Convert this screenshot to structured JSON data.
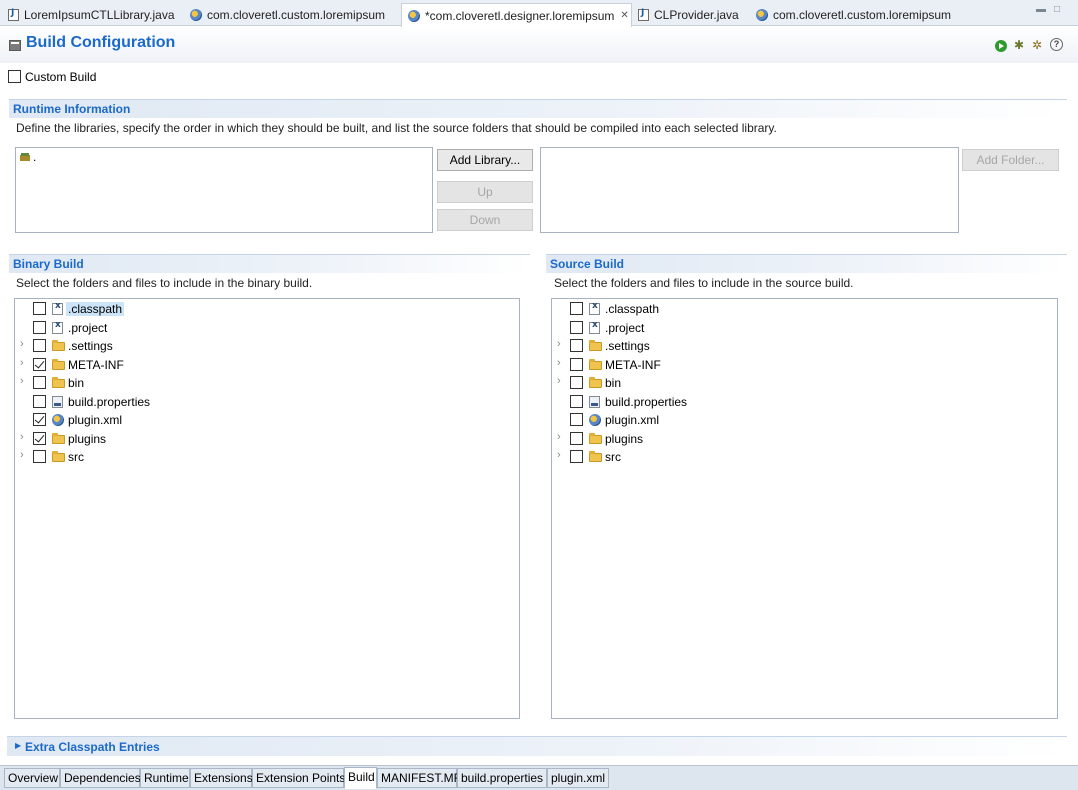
{
  "editor_tabs": [
    {
      "label": "LoremIpsumCTLLibrary.java",
      "icon": "java-file-icon",
      "active": false
    },
    {
      "label": "com.cloveretl.custom.loremipsum",
      "icon": "plugin-icon",
      "active": false
    },
    {
      "label": "*com.cloveretl.designer.loremipsum",
      "icon": "plugin-icon",
      "active": true
    },
    {
      "label": "CLProvider.java",
      "icon": "java-file-icon",
      "active": false
    },
    {
      "label": "com.cloveretl.custom.loremipsum",
      "icon": "plugin-icon",
      "active": false
    }
  ],
  "form": {
    "title": "Build Configuration"
  },
  "custom_build": {
    "label": "Custom Build",
    "checked": false
  },
  "runtime": {
    "title": "Runtime Information",
    "description": "Define the libraries, specify the order in which they should be built, and list the source folders that should be compiled into each selected library.",
    "libraries": [
      "."
    ],
    "add_library": "Add Library...",
    "up": "Up",
    "down": "Down",
    "add_folder": "Add Folder..."
  },
  "binary_build": {
    "title": "Binary Build",
    "description": "Select the folders and files to include in the binary build.",
    "items": [
      {
        "name": ".classpath",
        "type": "file",
        "checked": false,
        "expandable": false,
        "selected": true
      },
      {
        "name": ".project",
        "type": "file",
        "checked": false,
        "expandable": false,
        "selected": false
      },
      {
        "name": ".settings",
        "type": "folder",
        "checked": false,
        "expandable": true,
        "selected": false
      },
      {
        "name": "META-INF",
        "type": "folder",
        "checked": true,
        "expandable": true,
        "selected": false
      },
      {
        "name": "bin",
        "type": "folder",
        "checked": false,
        "expandable": true,
        "selected": false
      },
      {
        "name": "build.properties",
        "type": "properties",
        "checked": false,
        "expandable": false,
        "selected": false
      },
      {
        "name": "plugin.xml",
        "type": "plugin",
        "checked": true,
        "expandable": false,
        "selected": false
      },
      {
        "name": "plugins",
        "type": "folder",
        "checked": true,
        "expandable": true,
        "selected": false
      },
      {
        "name": "src",
        "type": "folder",
        "checked": false,
        "expandable": true,
        "selected": false
      }
    ]
  },
  "source_build": {
    "title": "Source Build",
    "description": "Select the folders and files to include in the source build.",
    "items": [
      {
        "name": ".classpath",
        "type": "file",
        "checked": false,
        "expandable": false,
        "selected": false
      },
      {
        "name": ".project",
        "type": "file",
        "checked": false,
        "expandable": false,
        "selected": false
      },
      {
        "name": ".settings",
        "type": "folder",
        "checked": false,
        "expandable": true,
        "selected": false
      },
      {
        "name": "META-INF",
        "type": "folder",
        "checked": false,
        "expandable": true,
        "selected": false
      },
      {
        "name": "bin",
        "type": "folder",
        "checked": false,
        "expandable": true,
        "selected": false
      },
      {
        "name": "build.properties",
        "type": "properties",
        "checked": false,
        "expandable": false,
        "selected": false
      },
      {
        "name": "plugin.xml",
        "type": "plugin",
        "checked": false,
        "expandable": false,
        "selected": false
      },
      {
        "name": "plugins",
        "type": "folder",
        "checked": false,
        "expandable": true,
        "selected": false
      },
      {
        "name": "src",
        "type": "folder",
        "checked": false,
        "expandable": true,
        "selected": false
      }
    ]
  },
  "extra_classpath": {
    "title": "Extra Classpath Entries"
  },
  "bottom_tabs": [
    {
      "label": "Overview",
      "active": false
    },
    {
      "label": "Dependencies",
      "active": false
    },
    {
      "label": "Runtime",
      "active": false
    },
    {
      "label": "Extensions",
      "active": false
    },
    {
      "label": "Extension Points",
      "active": false
    },
    {
      "label": "Build",
      "active": true
    },
    {
      "label": "MANIFEST.MF",
      "active": false
    },
    {
      "label": "build.properties",
      "active": false
    },
    {
      "label": "plugin.xml",
      "active": false
    }
  ],
  "colors": {
    "accent": "#1b6ac9",
    "selection": "#cce4f7"
  }
}
